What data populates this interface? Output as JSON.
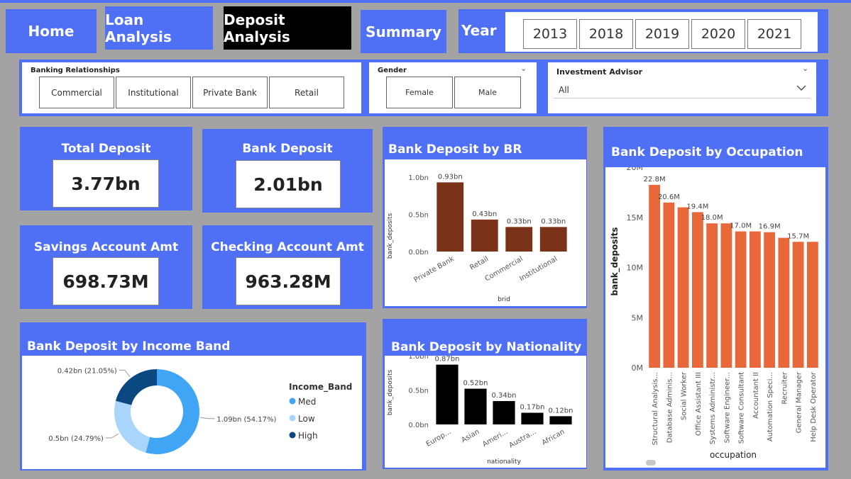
{
  "nav": {
    "home": "Home",
    "loan": "Loan Analysis",
    "deposit": "Deposit Analysis",
    "summary": "Summary",
    "year_label": "Year",
    "years": [
      "2013",
      "2018",
      "2019",
      "2020",
      "2021"
    ]
  },
  "slicers": {
    "banking": {
      "title": "Banking Relationships",
      "options": [
        "Commercial",
        "Institutional",
        "Private Bank",
        "Retail"
      ]
    },
    "gender": {
      "title": "Gender",
      "options": [
        "Female",
        "Male"
      ]
    },
    "advisor": {
      "title": "Investment Advisor",
      "value": "All"
    }
  },
  "cards": {
    "total_deposit": {
      "title": "Total Deposit",
      "value": "3.77bn"
    },
    "bank_deposit": {
      "title": "Bank Deposit",
      "value": "2.01bn"
    },
    "savings": {
      "title": "Savings Account Amt",
      "value": "698.73M"
    },
    "checking": {
      "title": "Checking Account Amt",
      "value": "963.28M"
    }
  },
  "colors": {
    "accent": "#4f6ff5",
    "brown": "#7a3219",
    "orange": "#e8683a",
    "black": "#000000",
    "donut_med": "#41a5f5",
    "donut_low": "#a9d4fb",
    "donut_high": "#0b4780"
  },
  "chart_data": [
    {
      "id": "br",
      "type": "bar",
      "title": "Bank Deposit by BR",
      "xlabel": "brid",
      "ylabel": "bank_deposits",
      "categories": [
        "Private Bank",
        "Retail",
        "Commercial",
        "Institutional"
      ],
      "values": [
        0.93,
        0.43,
        0.33,
        0.33
      ],
      "labels": [
        "0.93bn",
        "0.43bn",
        "0.33bn",
        "0.33bn"
      ],
      "yticks": [
        "0.0bn",
        "0.5bn",
        "1.0bn"
      ],
      "ylim": [
        0,
        1.0
      ]
    },
    {
      "id": "nat",
      "type": "bar",
      "title": "Bank Deposit by Nationality",
      "xlabel": "nationality",
      "ylabel": "bank_deposits",
      "categories": [
        "Europ...",
        "Asian",
        "Ameri...",
        "Austra...",
        "African"
      ],
      "values": [
        0.87,
        0.52,
        0.34,
        0.17,
        0.12
      ],
      "labels": [
        "0.87bn",
        "0.52bn",
        "0.34bn",
        "0.17bn",
        "0.12bn"
      ],
      "yticks": [
        "0.0bn",
        "0.5bn",
        "1.0bn"
      ],
      "ylim": [
        0,
        1.0
      ]
    },
    {
      "id": "occ",
      "type": "bar",
      "title": "Bank Deposit by Occupation",
      "xlabel": "occupation",
      "ylabel": "bank_deposits",
      "categories": [
        "Structural Analysis...",
        "Database Adminis...",
        "Social Worker",
        "Office Assistant III",
        "Systems Administr...",
        "Software Engineer...",
        "Software Consultant",
        "Accountant II",
        "Automation Speci...",
        "Recruiter",
        "General Manager",
        "Help Desk Operator"
      ],
      "values": [
        22.8,
        20.6,
        20.0,
        19.4,
        18.0,
        18.0,
        17.0,
        17.0,
        16.9,
        16.2,
        15.7,
        15.7
      ],
      "labels": [
        "22.8M",
        "20.6M",
        "",
        "19.4M",
        "18.0M",
        "",
        "17.0M",
        "",
        "16.9M",
        "",
        "15.7M",
        ""
      ],
      "yticks": [
        "0M",
        "5M",
        "10M",
        "15M",
        "20M"
      ],
      "ylim": [
        0,
        25
      ]
    },
    {
      "id": "income",
      "type": "pie",
      "title": "Bank Deposit by Income Band",
      "legend_title": "Income_Band",
      "categories": [
        "Med",
        "Low",
        "High"
      ],
      "values": [
        1.09,
        0.5,
        0.42
      ],
      "percents": [
        54.17,
        24.79,
        21.05
      ],
      "labels": [
        "1.09bn (54.17%)",
        "0.5bn (24.79%)",
        "0.42bn (21.05%)"
      ],
      "legend": "right"
    }
  ]
}
